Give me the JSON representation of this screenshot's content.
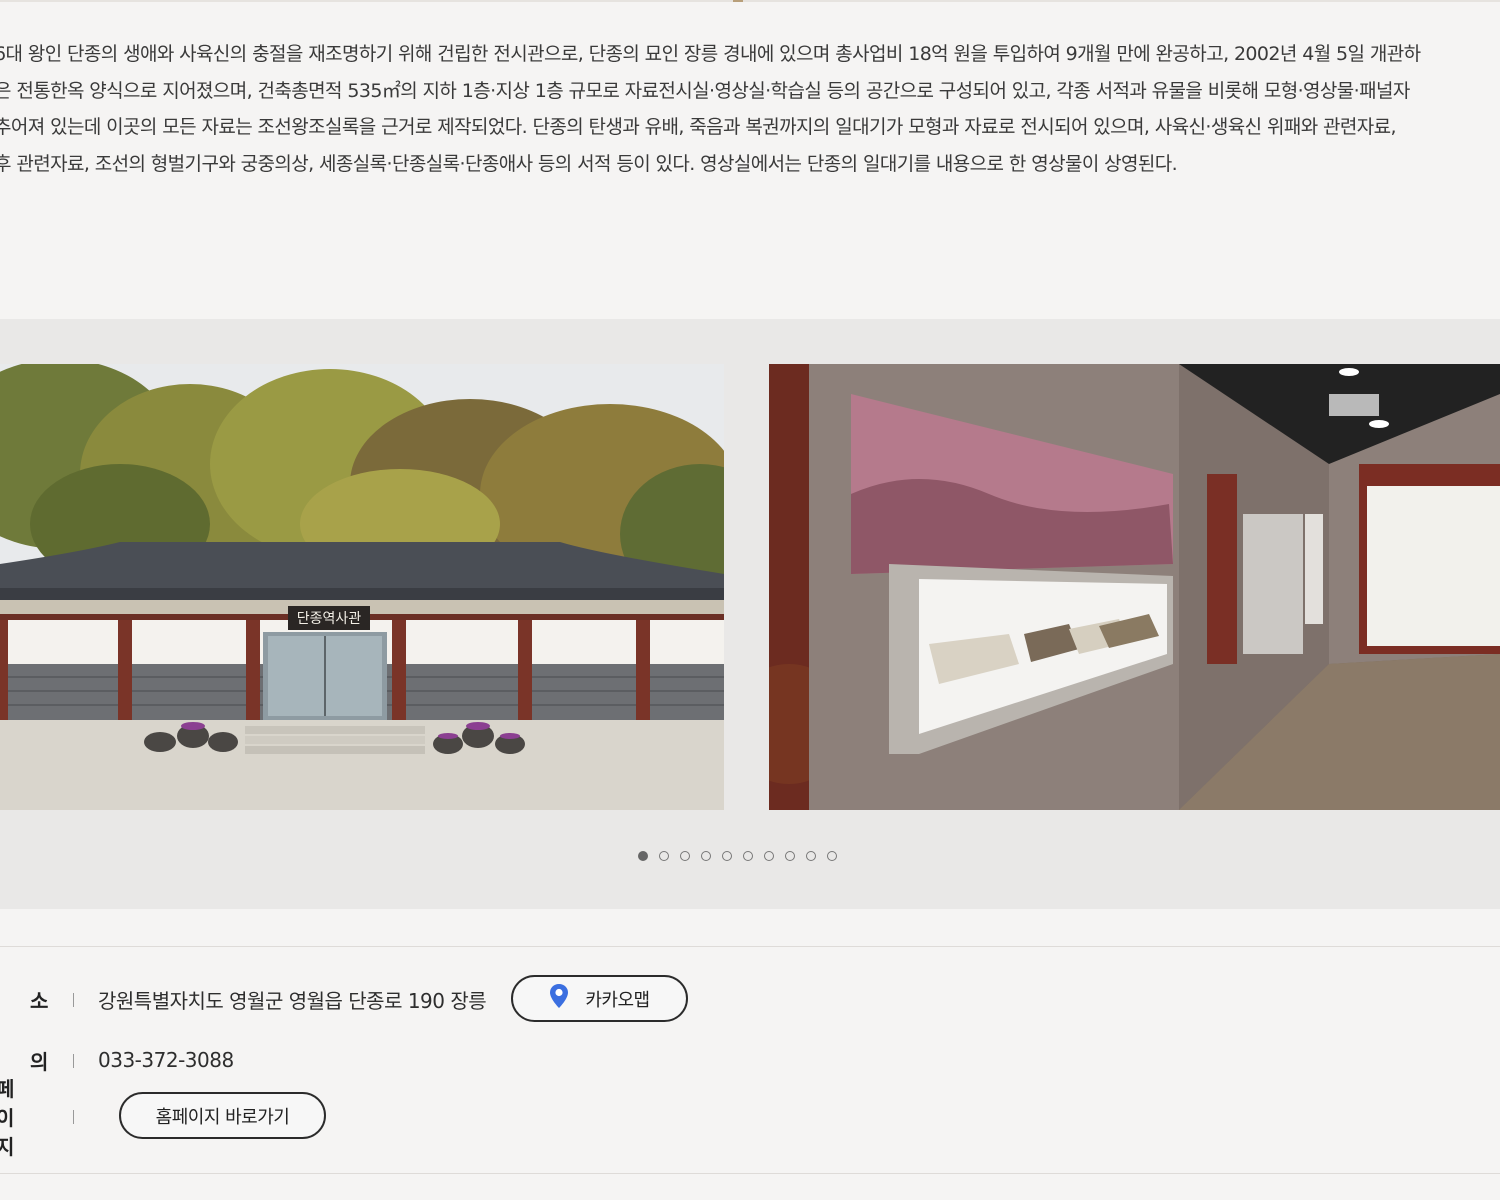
{
  "description": {
    "lines": [
      "6대 왕인 단종의 생애와 사육신의 충절을 재조명하기 위해 건립한 전시관으로, 단종의 묘인 장릉 경내에 있으며 총사업비 18억 원을 투입하여 9개월 만에 완공하고, 2002년 4월 5일 개관하",
      "은 전통한옥 양식으로 지어졌으며, 건축총면적 535㎡의 지하 1층·지상 1층 규모로 자료전시실·영상실·학습실 등의 공간으로 구성되어 있고, 각종 서적과 유물을 비롯해 모형·영상물·패널자",
      "추어져 있는데 이곳의 모든 자료는 조선왕조실록을 근거로 제작되었다. 단종의 탄생과 유배, 죽음과 복권까지의 일대기가 모형과 자료로 전시되어 있으며, 사육신·생육신 위패와 관련자료,",
      "후 관련자료, 조선의 형벌기구와 궁중의상, 세종실록·단종실록·단종애사 등의 서적 등이 있다. 영상실에서는 단종의 일대기를 내용으로 한 영상물이 상영된다."
    ]
  },
  "gallery": {
    "slide1_signboard": "단종역사관",
    "slide_count": 10,
    "active_index": 0
  },
  "info": {
    "address_label": "소",
    "address_value": "강원특별자치도 영월군 영월읍 단종로 190 장릉",
    "kakao_button": "카카오맵",
    "phone_label": "의",
    "phone_value": "033-372-3088",
    "homepage_label": "페이지",
    "homepage_button": "홈페이지 바로가기"
  },
  "colors": {
    "background": "#f5f4f3",
    "gallery_bg": "#e9e8e7",
    "pin": "#3b6fe0",
    "button_border": "#2b2b2b"
  },
  "icons": {
    "map_pin": "map-pin-icon"
  }
}
